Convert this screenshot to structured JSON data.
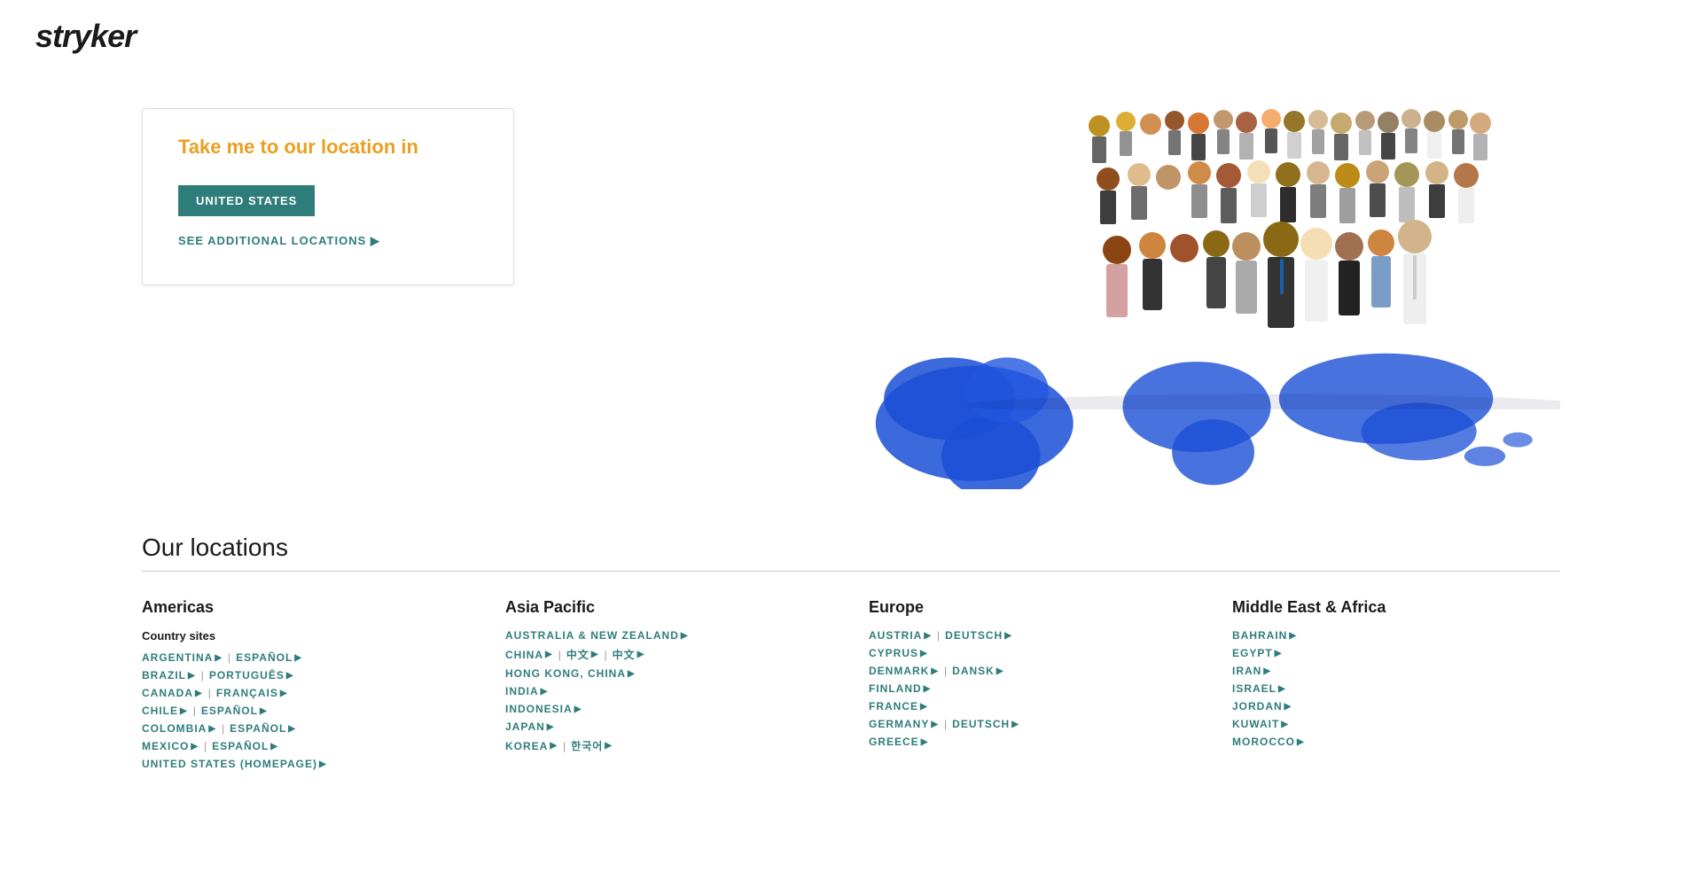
{
  "logo": {
    "text": "stryker"
  },
  "hero": {
    "card": {
      "title": "Take me to our location in",
      "button_label": "UNITED STATES",
      "see_more_label": "SEE ADDITIONAL LOCATIONS"
    }
  },
  "locations": {
    "title": "Our locations",
    "regions": [
      {
        "id": "americas",
        "name": "Americas",
        "country_sites_label": "Country sites",
        "countries": [
          {
            "name": "ARGENTINA",
            "links": [
              {
                "label": "ESPAÑOL"
              }
            ]
          },
          {
            "name": "BRAZIL",
            "links": [
              {
                "label": "PORTUGUÊS"
              }
            ]
          },
          {
            "name": "CANADA",
            "links": [
              {
                "label": "FRANÇAIS"
              }
            ]
          },
          {
            "name": "CHILE",
            "links": [
              {
                "label": "ESPAÑOL"
              }
            ]
          },
          {
            "name": "COLOMBIA",
            "links": [
              {
                "label": "ESPAÑOL"
              }
            ]
          },
          {
            "name": "MEXICO",
            "links": [
              {
                "label": "ESPAÑOL"
              }
            ]
          },
          {
            "name": "UNITED STATES (HOMEPAGE)",
            "links": []
          }
        ]
      },
      {
        "id": "asia-pacific",
        "name": "Asia Pacific",
        "country_sites_label": "",
        "countries": [
          {
            "name": "AUSTRALIA & NEW ZEALAND",
            "links": []
          },
          {
            "name": "CHINA",
            "links": [
              {
                "label": "中文"
              },
              {
                "label": "中文"
              }
            ]
          },
          {
            "name": "HONG KONG, CHINA",
            "links": []
          },
          {
            "name": "INDIA",
            "links": []
          },
          {
            "name": "INDONESIA",
            "links": []
          },
          {
            "name": "JAPAN",
            "links": []
          },
          {
            "name": "KOREA",
            "links": [
              {
                "label": "한국어"
              }
            ]
          }
        ]
      },
      {
        "id": "europe",
        "name": "Europe",
        "country_sites_label": "",
        "countries": [
          {
            "name": "AUSTRIA",
            "links": [
              {
                "label": "DEUTSCH"
              }
            ]
          },
          {
            "name": "CYPRUS",
            "links": []
          },
          {
            "name": "DENMARK",
            "links": [
              {
                "label": "DANSK"
              }
            ]
          },
          {
            "name": "FINLAND",
            "links": []
          },
          {
            "name": "FRANCE",
            "links": []
          },
          {
            "name": "GERMANY",
            "links": [
              {
                "label": "DEUTSCH"
              }
            ]
          },
          {
            "name": "GREECE",
            "links": []
          }
        ]
      },
      {
        "id": "middle-east-africa",
        "name": "Middle East & Africa",
        "country_sites_label": "",
        "countries": [
          {
            "name": "BAHRAIN",
            "links": []
          },
          {
            "name": "EGYPT",
            "links": []
          },
          {
            "name": "IRAN",
            "links": []
          },
          {
            "name": "ISRAEL",
            "links": []
          },
          {
            "name": "JORDAN",
            "links": []
          },
          {
            "name": "KUWAIT",
            "links": []
          },
          {
            "name": "MOROCCO",
            "links": []
          }
        ]
      }
    ]
  }
}
